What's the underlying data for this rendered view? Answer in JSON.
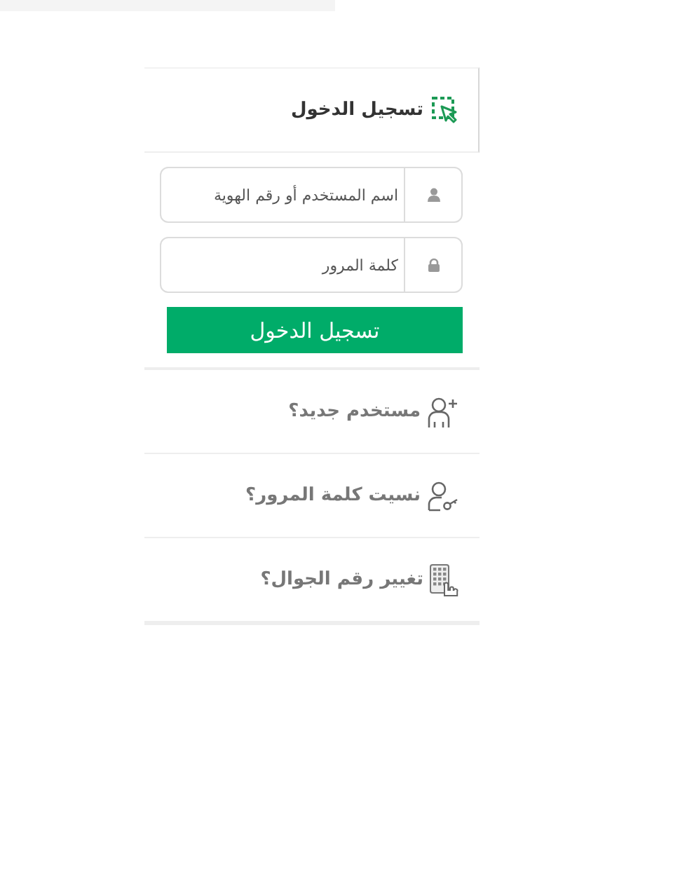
{
  "login_panel": {
    "title": "تسجيل الدخول",
    "fields": [
      {
        "kind": "user",
        "placeholder": "اسم المستخدم أو رقم الهوية"
      },
      {
        "kind": "password",
        "placeholder": "كلمة المرور"
      }
    ],
    "submit": "تسجيل الدخول",
    "links": [
      {
        "kind": "register",
        "label": "مستخدم جديد؟"
      },
      {
        "kind": "recover",
        "label": "نسيت كلمة المرور؟"
      },
      {
        "kind": "mobile",
        "label": "تغيير رقم الجوال؟"
      }
    ]
  }
}
